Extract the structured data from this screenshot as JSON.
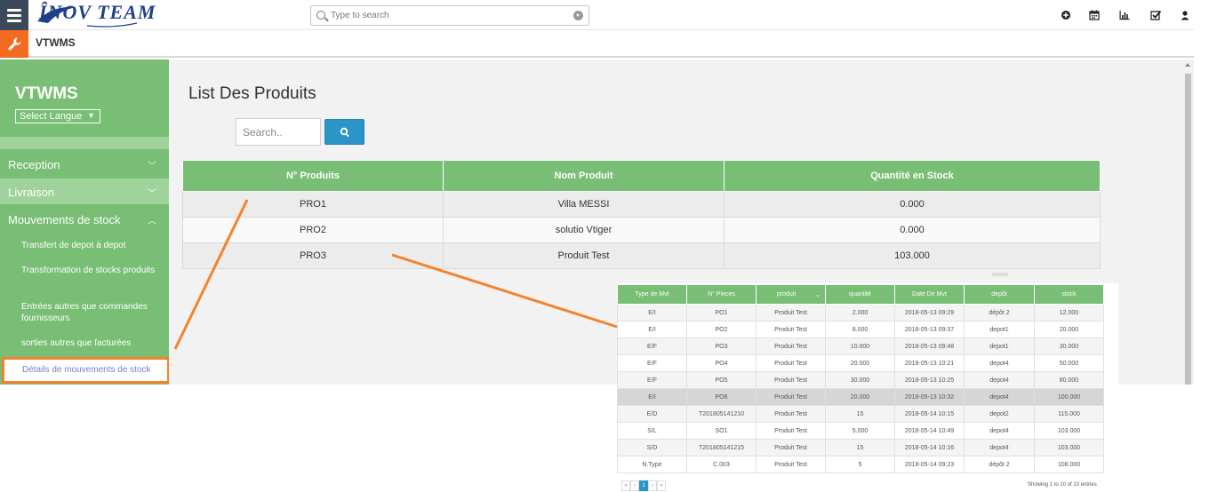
{
  "header": {
    "logo_text": "ÎNOV TEAM",
    "search_placeholder": "Type to search",
    "icons": [
      "plus-circle-icon",
      "calendar-icon",
      "bar-chart-icon",
      "checkbox-icon",
      "user-icon"
    ]
  },
  "subbar": {
    "title": "VTWMS"
  },
  "sidebar": {
    "title": "VTWMS",
    "lang_label": "Select Langue",
    "items": [
      {
        "label": "Reception",
        "chevron": "down"
      },
      {
        "label": "Livraison",
        "chevron": "down"
      },
      {
        "label": "Mouvements de stock",
        "chevron": "up"
      }
    ],
    "subitems": [
      "Transfert de depot à depot",
      "Transformation de stocks produits",
      "Entrées autres que commandes fournisseurs",
      "sorties autres que facturées"
    ],
    "active_subitem": "Détails de mouvements de stock"
  },
  "main": {
    "title": "List Des Produits",
    "search_placeholder": "Search..",
    "table": {
      "headers": [
        "N° Produits",
        "Nom Produit",
        "Quantité en Stock"
      ],
      "rows": [
        [
          "PRO1",
          "Villa MESSI",
          "0.000"
        ],
        [
          "PRO2",
          "solutio Vtiger",
          "0.000"
        ],
        [
          "PRO3",
          "Produit Test",
          "103.000"
        ]
      ]
    }
  },
  "inset": {
    "table": {
      "headers": [
        "Type de Mvt",
        "N° Pieces",
        "produit",
        "quantité",
        "Date De Mvt",
        "depôt",
        "stock"
      ],
      "rows": [
        [
          "E/I",
          "PO1",
          "Produit Test",
          "2.000",
          "2018-05-13 09:29",
          "dépôt 2",
          "12.000"
        ],
        [
          "E/I",
          "PO2",
          "Produit Test",
          "8.000",
          "2018-05-13 09:37",
          "depot1",
          "20.000"
        ],
        [
          "E/F",
          "PO3",
          "Produit Test",
          "10.000",
          "2018-05-13 09:48",
          "depot1",
          "30.000"
        ],
        [
          "E/F",
          "PO4",
          "Produit Test",
          "20.000",
          "2018-05-13 10:21",
          "depot4",
          "50.000"
        ],
        [
          "E/F",
          "PO5",
          "Produit Test",
          "30.000",
          "2018-05-13 10:25",
          "depot4",
          "80.000"
        ],
        [
          "E/I",
          "PO6",
          "Produit Test",
          "20.000",
          "2018-05-13 10:32",
          "depot4",
          "100.000"
        ],
        [
          "E/D",
          "T201805141210",
          "Produit Test",
          "15",
          "2018-05-14 10:15",
          "depot2",
          "115.000"
        ],
        [
          "S/L",
          "SO1",
          "Produit Test",
          "5.000",
          "2018-05-14 10:49",
          "depot4",
          "103.000"
        ],
        [
          "S/D",
          "T201805141215",
          "Produit Test",
          "15",
          "2018-05-14 10:16",
          "depot4",
          "103.000"
        ],
        [
          "N.Type",
          "C.003",
          "Produit Test",
          "5",
          "2018-05-14 09:23",
          "dépôt 2",
          "108.000"
        ]
      ]
    },
    "pager": [
      "«",
      "‹",
      "1",
      "›",
      "»"
    ],
    "showing_text": "Showing 1 to 10 of 10 entries"
  },
  "colors": {
    "sidebar_green": "#78be74",
    "accent_orange": "#f36b21",
    "callout_orange": "#f5822b",
    "button_blue": "#2b95c8",
    "topbar_dark": "#3b4a5a"
  }
}
